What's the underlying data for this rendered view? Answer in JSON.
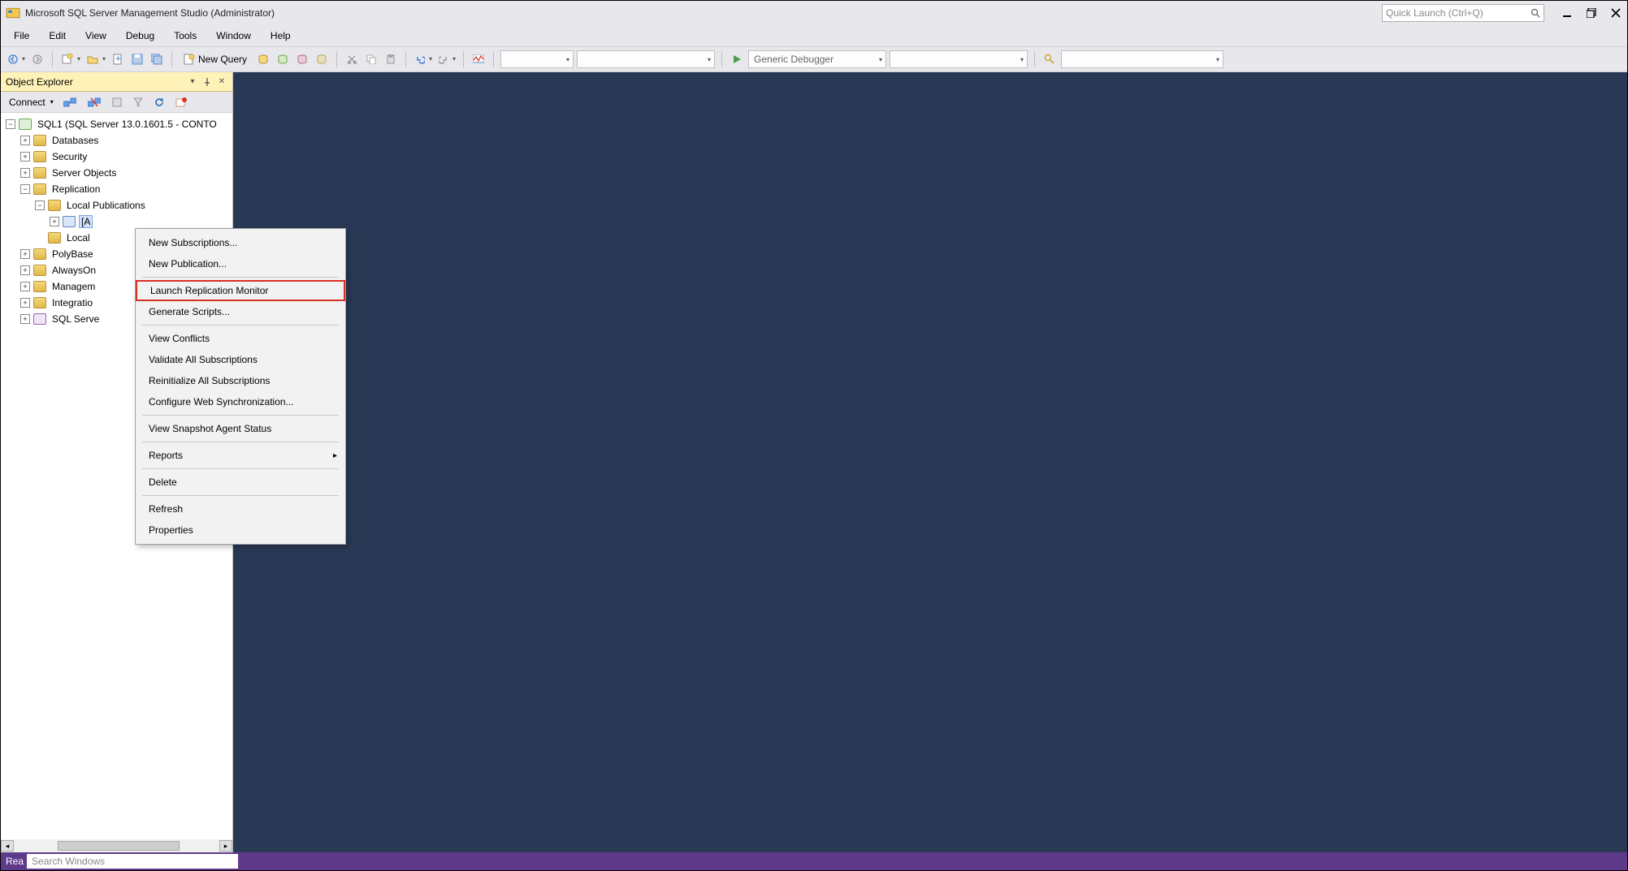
{
  "titlebar": {
    "title": "Microsoft SQL Server Management Studio (Administrator)",
    "quick_launch_placeholder": "Quick Launch (Ctrl+Q)"
  },
  "menubar": [
    "File",
    "Edit",
    "View",
    "Debug",
    "Tools",
    "Window",
    "Help"
  ],
  "toolbar": {
    "new_query": "New Query",
    "debugger_combo": "Generic Debugger"
  },
  "object_explorer": {
    "header": "Object Explorer",
    "toolbar": {
      "connect": "Connect"
    },
    "root": "SQL1 (SQL Server 13.0.1601.5 - CONTO",
    "nodes": {
      "databases": "Databases",
      "security": "Security",
      "server_objects": "Server Objects",
      "replication": "Replication",
      "local_publications": "Local Publications",
      "publication_selected": "[A",
      "local_subscriptions": "Local",
      "polybase": "PolyBase",
      "alwayson": "AlwaysOn",
      "management": "Managem",
      "integration": "Integratio",
      "sql_server_agent": "SQL Serve"
    }
  },
  "context_menu": {
    "items": [
      "New Subscriptions...",
      "New Publication...",
      "Launch Replication Monitor",
      "Generate Scripts...",
      "View Conflicts",
      "Validate All Subscriptions",
      "Reinitialize All Subscriptions",
      "Configure Web Synchronization...",
      "View Snapshot Agent Status",
      "Reports",
      "Delete",
      "Refresh",
      "Properties"
    ]
  },
  "statusbar": {
    "ready": "Rea",
    "search_placeholder": "Search Windows"
  }
}
